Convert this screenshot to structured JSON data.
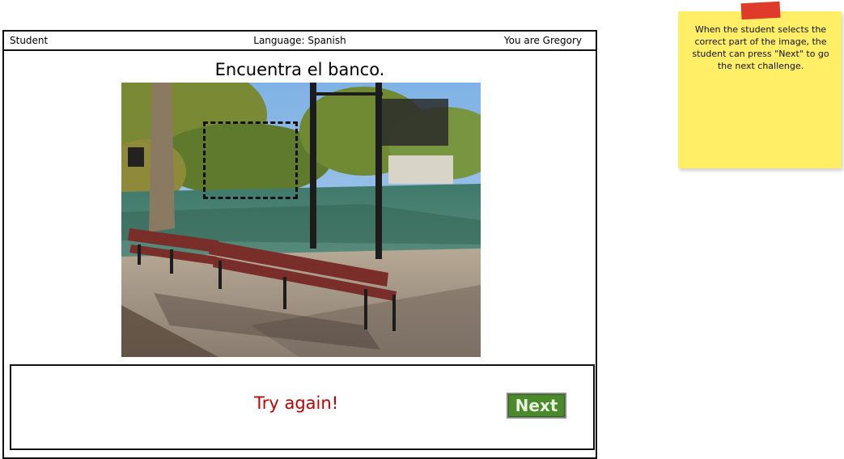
{
  "header": {
    "user_role": "Student",
    "language": "Language: Spanish",
    "identity": "You are Gregory"
  },
  "challenge": {
    "prompt": "Encuentra el banco.",
    "image_icon": "park-bench-photo"
  },
  "feedback": {
    "message": "Try again!",
    "next_label": "Next",
    "message_color": "#c40000",
    "next_color": "#4a8a2a"
  },
  "note": {
    "text": "When the student selects the correct part of the image, the student can press \"Next\" to go the next challenge.",
    "color": "#ffee66",
    "tape_color": "#e03b2a"
  }
}
